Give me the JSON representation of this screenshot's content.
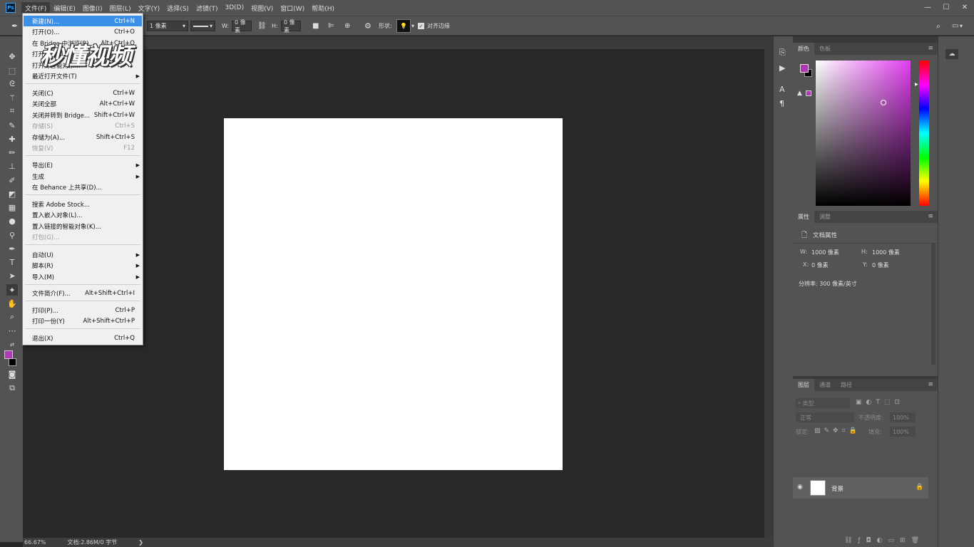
{
  "app": {
    "logo": "Ps"
  },
  "menubar": {
    "items": [
      "文件(F)",
      "编辑(E)",
      "图像(I)",
      "图层(L)",
      "文字(Y)",
      "选择(S)",
      "滤镜(T)",
      "3D(D)",
      "视图(V)",
      "窗口(W)",
      "帮助(H)"
    ]
  },
  "window_controls": {
    "minimize": "—",
    "maximize": "☐",
    "close": "✕"
  },
  "options": {
    "stroke_width": "1 像素",
    "w_label": "W:",
    "w_value": "0 像素",
    "h_label": "H:",
    "h_value": "0 像素",
    "shape_label": "形状:",
    "align_edges": "对齐边缘",
    "align_edges_checked": true
  },
  "file_menu": {
    "items": [
      {
        "label": "新建(N)...",
        "shortcut": "Ctrl+N",
        "state": "highlight"
      },
      {
        "label": "打开(O)...",
        "shortcut": "Ctrl+O"
      },
      {
        "label": "在 Bridge 中浏览(B)...",
        "shortcut": "Alt+Ctrl+O"
      },
      {
        "label": "打开为...",
        "shortcut": "Alt+Shift+Ctrl+O"
      },
      {
        "label": "打开为智能对象...",
        "shortcut": ""
      },
      {
        "label": "最近打开文件(T)",
        "shortcut": "",
        "submenu": true
      },
      {
        "label": "关闭(C)",
        "shortcut": "Ctrl+W"
      },
      {
        "label": "关闭全部",
        "shortcut": "Alt+Ctrl+W"
      },
      {
        "label": "关闭并转到 Bridge...",
        "shortcut": "Shift+Ctrl+W"
      },
      {
        "label": "存储(S)",
        "shortcut": "Ctrl+S",
        "state": "disabled"
      },
      {
        "label": "存储为(A)...",
        "shortcut": "Shift+Ctrl+S"
      },
      {
        "label": "恢复(V)",
        "shortcut": "F12",
        "state": "disabled"
      },
      {
        "label": "导出(E)",
        "shortcut": "",
        "submenu": true
      },
      {
        "label": "生成",
        "shortcut": "",
        "submenu": true
      },
      {
        "label": "在 Behance 上共享(D)...",
        "shortcut": ""
      },
      {
        "label": "搜索 Adobe Stock...",
        "shortcut": ""
      },
      {
        "label": "置入嵌入对象(L)...",
        "shortcut": ""
      },
      {
        "label": "置入链接的智能对象(K)...",
        "shortcut": ""
      },
      {
        "label": "打包(G)...",
        "shortcut": "",
        "state": "disabled"
      },
      {
        "label": "自动(U)",
        "shortcut": "",
        "submenu": true
      },
      {
        "label": "脚本(R)",
        "shortcut": "",
        "submenu": true
      },
      {
        "label": "导入(M)",
        "shortcut": "",
        "submenu": true
      },
      {
        "label": "文件简介(F)...",
        "shortcut": "Alt+Shift+Ctrl+I"
      },
      {
        "label": "打印(P)...",
        "shortcut": "Ctrl+P"
      },
      {
        "label": "打印一份(Y)",
        "shortcut": "Alt+Shift+Ctrl+P"
      },
      {
        "label": "退出(X)",
        "shortcut": "Ctrl+Q"
      }
    ]
  },
  "watermark": {
    "text": "秒懂视频"
  },
  "status": {
    "zoom": "66.67%",
    "doc": "文档:2.86M/0 字节",
    "arrow": "❯"
  },
  "panels": {
    "color": {
      "tabs": [
        "颜色",
        "色板"
      ],
      "foreground": "#b03ab5",
      "background": "#000000",
      "hue_color": "#e23ef0"
    },
    "properties": {
      "tabs": [
        "属性",
        "调整"
      ],
      "title": "文档属性",
      "w_label": "W:",
      "w_value": "1000 像素",
      "h_label": "H:",
      "h_value": "1000 像素",
      "x_label": "X:",
      "x_value": "0 像素",
      "y_label": "Y:",
      "y_value": "0 像素",
      "resolution": "分辨率: 300 像素/英寸"
    },
    "layers": {
      "tabs": [
        "图层",
        "通道",
        "路径"
      ],
      "filter": "类型",
      "blend": "正常",
      "opacity_label": "不透明度:",
      "opacity": "100%",
      "lock_label": "锁定:",
      "fill_label": "填充:",
      "fill": "100%",
      "layer_name": "背景"
    }
  },
  "accent": "#3c8fe6"
}
